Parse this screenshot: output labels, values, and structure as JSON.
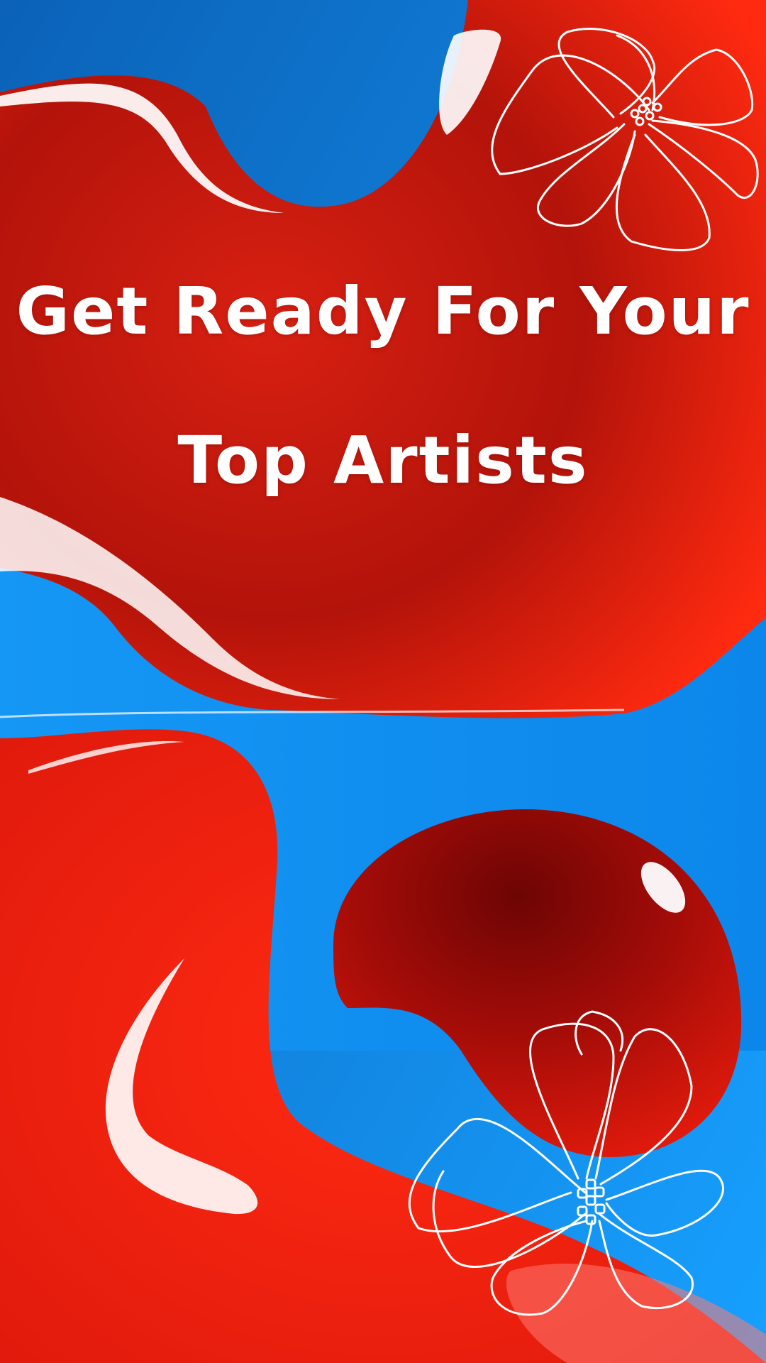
{
  "story": {
    "headline_line1": "Get Ready For Your",
    "headline_line2": "Top Artists"
  },
  "colors": {
    "red": "#f0230f",
    "deep_red": "#8a0a06",
    "blue": "#0d8ef0",
    "deep_blue": "#0a5fb8",
    "white": "#ffffff"
  },
  "decorations": [
    "flower-outline-icon",
    "flower-outline-icon"
  ]
}
